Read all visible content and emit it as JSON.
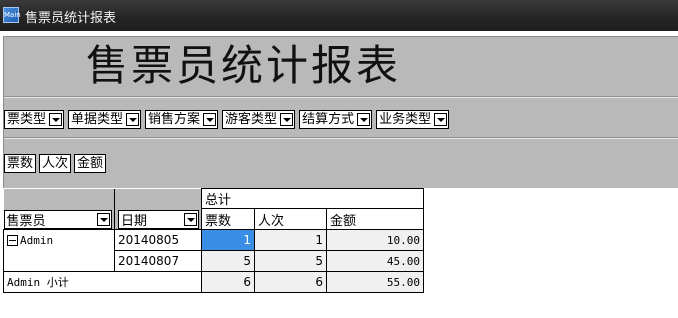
{
  "window": {
    "title": "售票员统计报表",
    "icon": "app-icon",
    "icon_text": "Main"
  },
  "report": {
    "title": "售票员统计报表"
  },
  "filters": [
    {
      "label": "票类型"
    },
    {
      "label": "单据类型"
    },
    {
      "label": "销售方案"
    },
    {
      "label": "游客类型"
    },
    {
      "label": "结算方式"
    },
    {
      "label": "业务类型"
    }
  ],
  "measures": [
    {
      "label": "票数"
    },
    {
      "label": "人次"
    },
    {
      "label": "金额"
    }
  ],
  "grid": {
    "group_header": "总计",
    "row_fields": [
      {
        "label": "售票员"
      },
      {
        "label": "日期"
      }
    ],
    "columns": [
      "票数",
      "人次",
      "金额"
    ],
    "groups": [
      {
        "name": "Admin",
        "rows": [
          {
            "date": "20140805",
            "tickets": "1",
            "visits": "1",
            "amount": "10.00"
          },
          {
            "date": "20140807",
            "tickets": "5",
            "visits": "5",
            "amount": "45.00"
          }
        ],
        "subtotal": {
          "label": "Admin 小计",
          "tickets": "6",
          "visits": "6",
          "amount": "55.00"
        }
      }
    ]
  },
  "colors": {
    "header_bg": "#b9b9b9",
    "selection": "#3a8ee6",
    "titlebar": "#262626"
  }
}
